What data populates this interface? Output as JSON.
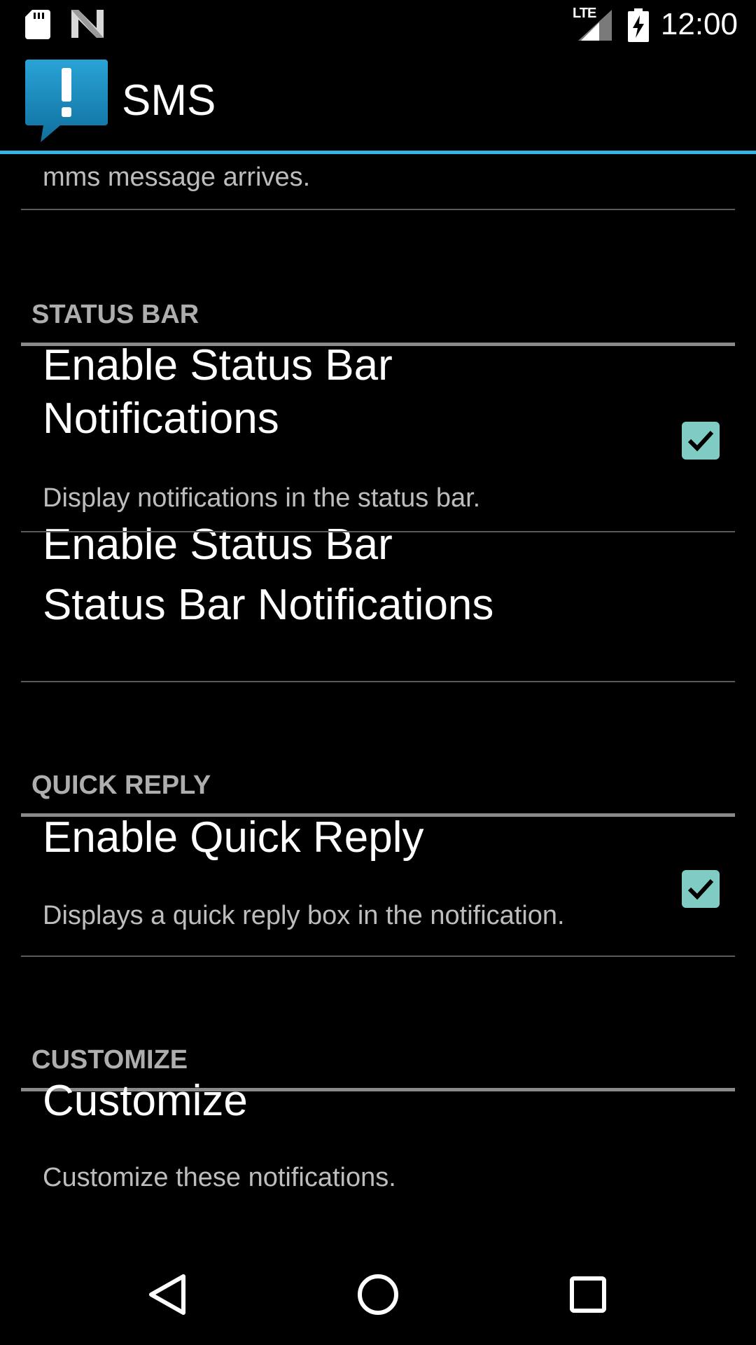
{
  "status_bar": {
    "network": "LTE",
    "time": "12:00"
  },
  "app_bar": {
    "title": "SMS",
    "icon": "exclamation-speech-bubble-icon",
    "divider_color": "#33b5e5"
  },
  "list": {
    "partial_top_summary": "mms message arrives.",
    "categories": [
      {
        "title": "STATUS BAR",
        "items": [
          {
            "title_line1": "Enable Status Bar",
            "title_line2": "Notifications",
            "summary": "Display notifications in the status bar.",
            "checked": true
          },
          {
            "title": "Status Bar Notifications"
          }
        ]
      },
      {
        "title": "QUICK REPLY",
        "items": [
          {
            "title": "Enable Quick Reply",
            "summary": "Displays a quick reply box in the notification.",
            "checked": true
          }
        ]
      },
      {
        "title": "CUSTOMIZE",
        "items": [
          {
            "title": "Customize",
            "summary": "Customize these notifications."
          }
        ]
      }
    ]
  },
  "nav_bar": {
    "back": "back-icon",
    "home": "home-icon",
    "recents": "recents-icon"
  },
  "colors": {
    "checkbox_fill": "#80cbc4",
    "background": "#000000"
  }
}
